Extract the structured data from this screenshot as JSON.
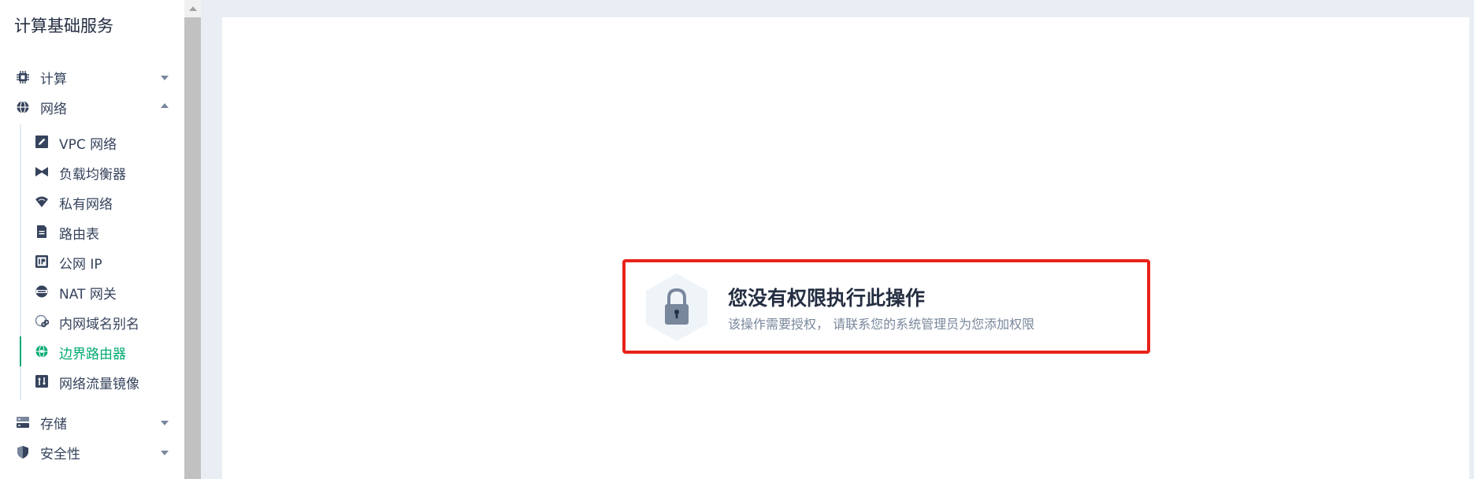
{
  "sidebar": {
    "title": "计算基础服务",
    "groups": [
      {
        "label": "计算",
        "icon": "chip-icon",
        "expanded": false
      },
      {
        "label": "网络",
        "icon": "globe-icon",
        "expanded": true
      },
      {
        "label": "存储",
        "icon": "storage-icon",
        "expanded": false
      },
      {
        "label": "安全性",
        "icon": "shield-icon",
        "expanded": false
      }
    ],
    "network_items": [
      {
        "label": "VPC 网络",
        "icon": "vpc-edit-icon"
      },
      {
        "label": "负载均衡器",
        "icon": "load-balancer-icon"
      },
      {
        "label": "私有网络",
        "icon": "wifi-icon"
      },
      {
        "label": "路由表",
        "icon": "route-table-icon"
      },
      {
        "label": "公网 IP",
        "icon": "ip-icon"
      },
      {
        "label": "NAT 网关",
        "icon": "nat-gateway-icon"
      },
      {
        "label": "内网域名别名",
        "icon": "link-globe-icon"
      },
      {
        "label": "边界路由器",
        "icon": "border-router-icon",
        "active": true
      },
      {
        "label": "网络流量镜像",
        "icon": "traffic-mirror-icon"
      }
    ]
  },
  "notice": {
    "title": "您没有权限执行此操作",
    "description": "该操作需要授权， 请联系您的系统管理员为您添加权限",
    "icon": "lock-icon"
  },
  "colors": {
    "accent": "#00aa72",
    "highlight_border": "#e8231a",
    "text": "#36435c",
    "muted": "#79879c"
  }
}
